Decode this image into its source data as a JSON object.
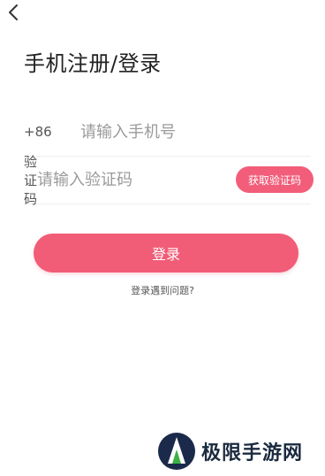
{
  "header": {
    "back_icon": "chevron-left-icon",
    "title": "手机注册/登录"
  },
  "form": {
    "phone": {
      "prefix": "+86",
      "placeholder": "请输入手机号",
      "value": ""
    },
    "code": {
      "label": "验证码",
      "placeholder": "请输入验证码",
      "value": "",
      "get_code_label": "获取验证码"
    },
    "login_label": "登录",
    "help_link": "登录遇到问题?"
  },
  "colors": {
    "accent": "#f15c77",
    "title": "#222222",
    "placeholder": "#9a9a9a"
  },
  "watermark": {
    "text": "极限手游网"
  }
}
